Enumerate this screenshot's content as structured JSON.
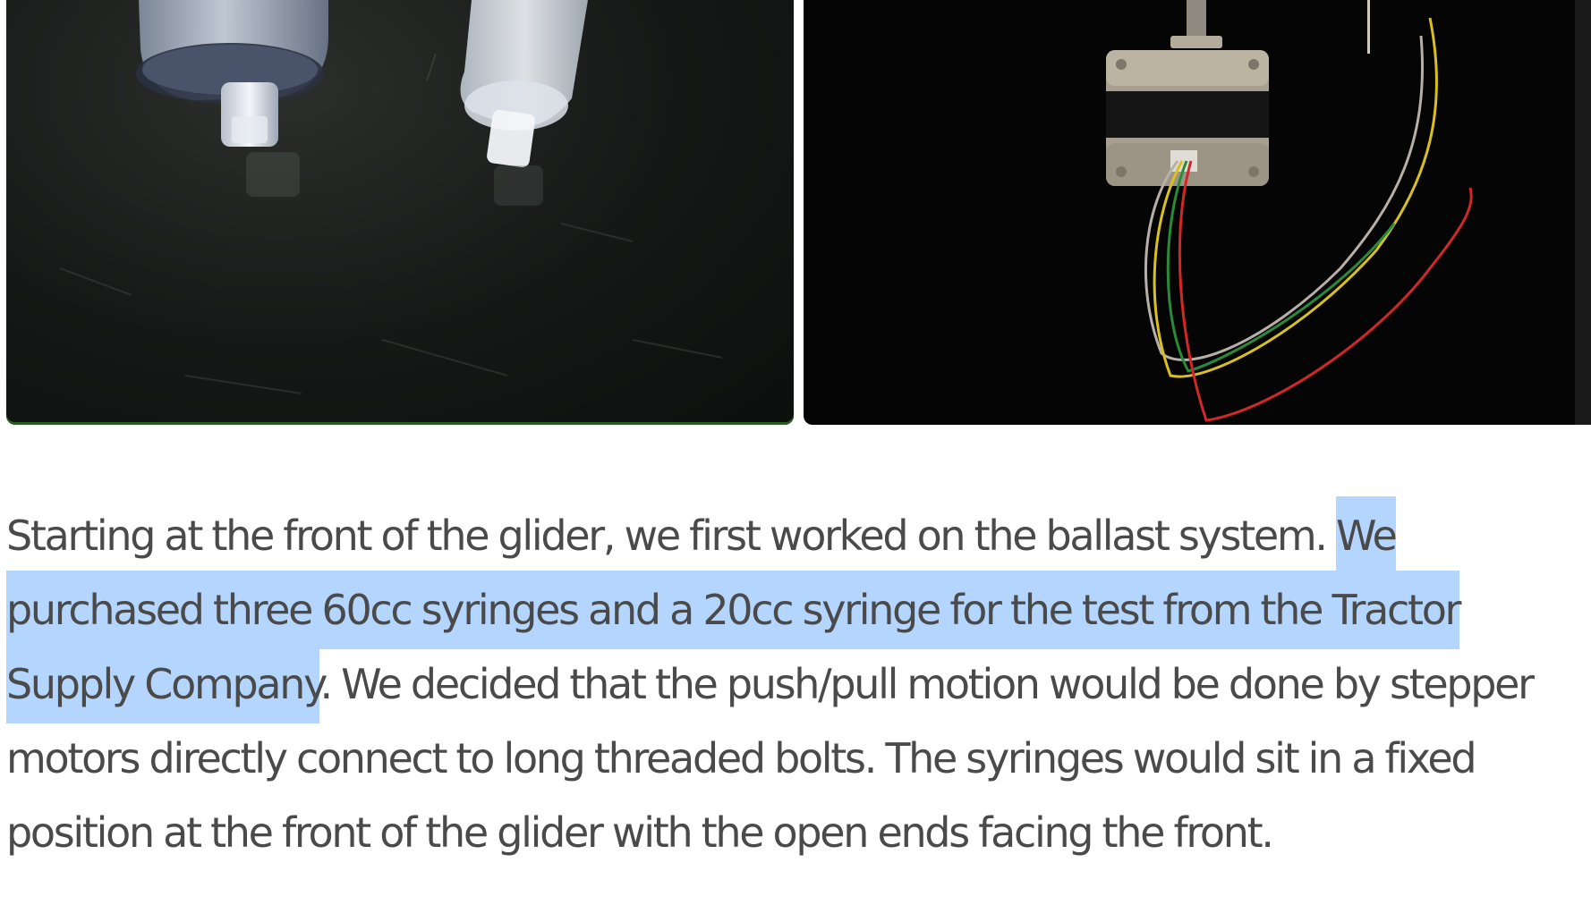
{
  "photos": [
    {
      "subject": "syringes-photo",
      "background": "#161817",
      "accent": "#2d5a25"
    },
    {
      "subject": "stepper-motor-photo",
      "background": "#050505",
      "wire_colors": [
        "#b8b0a8",
        "#d8c020",
        "#2a8a3a",
        "#d02828"
      ]
    }
  ],
  "article": {
    "text_before_selection": "Starting at the front of the glider, we first worked on the ballast system. ",
    "selected_text": "We purchased three 60cc syringes and a 20cc syringe for the test from the Tractor Supply Company",
    "text_after_selection": ". We decided that the push/pull motion would be done by stepper motors directly connect to long threaded bolts. The syringes would sit in a fixed position at the front of the glider with the open ends facing the front."
  },
  "colors": {
    "text": "#4a4a4a",
    "selection": "#b4d5fe",
    "background": "#ffffff"
  }
}
